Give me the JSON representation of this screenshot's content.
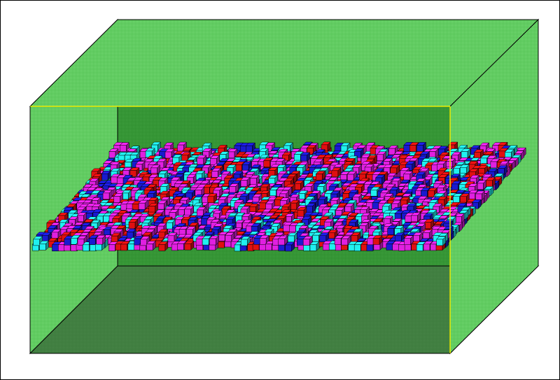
{
  "scene": {
    "type": "3d-lattice-visualization",
    "colors": {
      "background": "#ffffff",
      "frame": "#000000",
      "back_wall": "#2f8f2f",
      "side_walls": "#56c456",
      "floor": "#3d7a3d",
      "front_edge": "#e8e800",
      "cube_red": "#e01010",
      "cube_blue": "#1a1ad0",
      "cube_magenta": "#e020e0",
      "cube_cyan": "#20f0f0"
    }
  }
}
